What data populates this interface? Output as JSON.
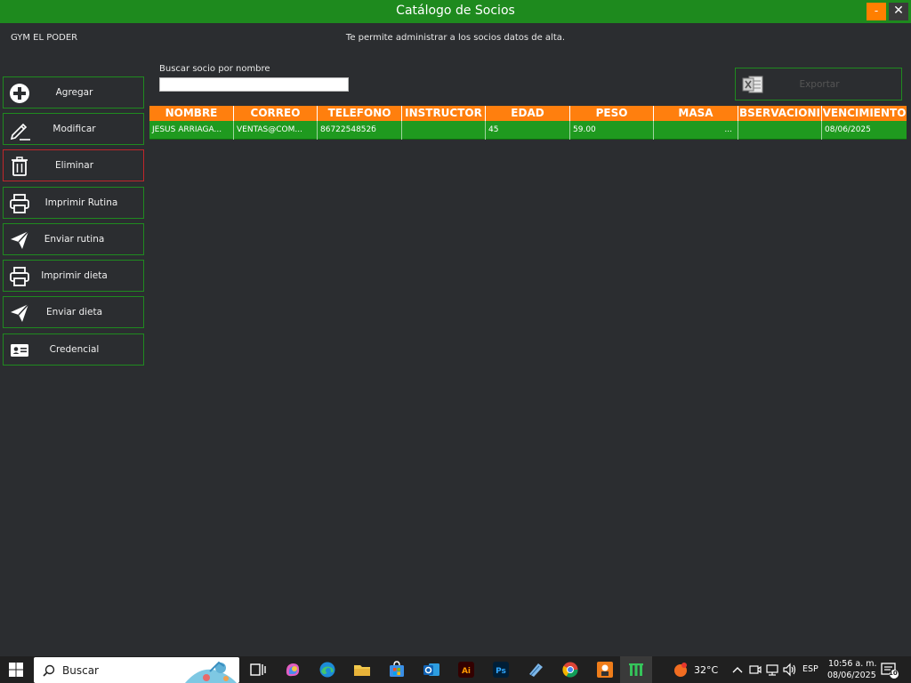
{
  "window": {
    "title": "Catálogo de Socios",
    "minimize_label": "-",
    "close_label": "✕"
  },
  "header": {
    "gym_name": "GYM EL PODER",
    "subtitle": "Te permite administrar a los socios datos de alta."
  },
  "sidebar": {
    "items": [
      {
        "label": "Agregar",
        "icon": "plus-circle-icon"
      },
      {
        "label": "Modificar",
        "icon": "pencil-icon"
      },
      {
        "label": "Eliminar",
        "icon": "trash-icon"
      },
      {
        "label": "Imprimir Rutina",
        "icon": "printer-icon"
      },
      {
        "label": "Enviar rutina",
        "icon": "paper-plane-icon"
      },
      {
        "label": "Imprimir dieta",
        "icon": "printer-icon"
      },
      {
        "label": "Enviar dieta",
        "icon": "paper-plane-icon"
      },
      {
        "label": "Credencial",
        "icon": "id-card-icon"
      }
    ]
  },
  "search": {
    "label": "Buscar socio por nombre",
    "value": "",
    "placeholder": ""
  },
  "export": {
    "label": "Exportar",
    "icon": "excel-icon"
  },
  "table": {
    "headers": [
      "NOMBRE",
      "CORREO",
      "TELEFONO",
      "INSTRUCTOR",
      "EDAD",
      "PESO",
      "MASA",
      "BSERVACIONI",
      "VENCIMIENTO"
    ],
    "rows": [
      [
        "JESUS ARRIAGA...",
        "VENTAS@COM...",
        "8672254852б",
        "",
        "45",
        "59.00",
        "...",
        "",
        "08/06/2025"
      ]
    ]
  },
  "taskbar": {
    "search_text": "Buscar",
    "weather": "32°C",
    "language": "ESP",
    "time": "10:56 a. m.",
    "date": "08/06/2025",
    "notifications": "10"
  },
  "colors": {
    "accent_green": "#1e8a1e",
    "accent_orange": "#ff7f0e",
    "danger_red": "#c0262b",
    "background": "#2b2d30"
  }
}
